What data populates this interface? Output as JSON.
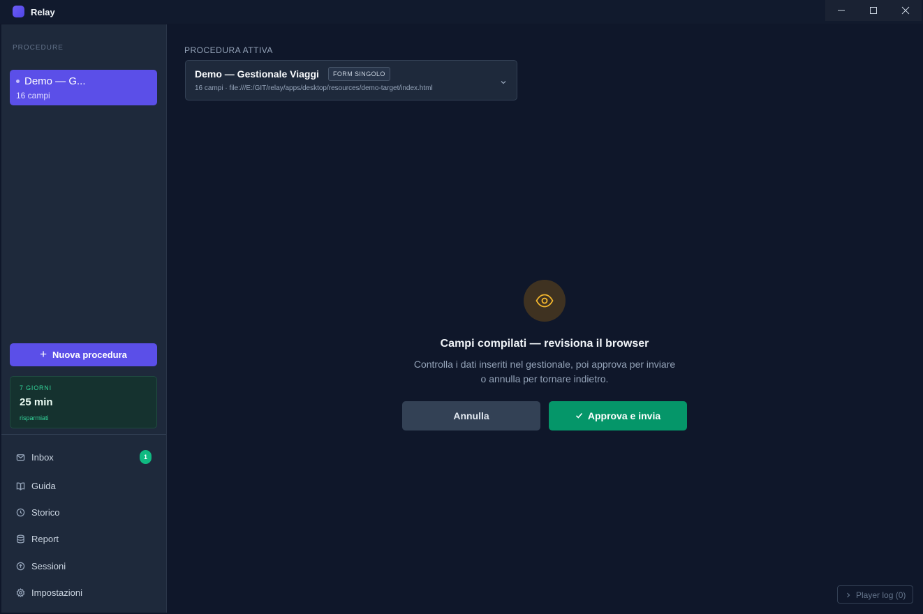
{
  "app": {
    "title": "Relay"
  },
  "sidebar": {
    "section_label": "PROCEDURE",
    "procedures": [
      {
        "title": "Demo — G...",
        "subtitle": "16 campi"
      }
    ],
    "new_button_label": "Nuova procedura",
    "stats": {
      "period": "7 GIORNI",
      "value": "25 min",
      "caption": "risparmiati"
    },
    "nav": [
      {
        "label": "Inbox",
        "icon": "mail-icon",
        "badge": "1"
      },
      {
        "label": "Guida",
        "icon": "book-icon"
      },
      {
        "label": "Storico",
        "icon": "clock-icon"
      },
      {
        "label": "Report",
        "icon": "database-icon"
      },
      {
        "label": "Sessioni",
        "icon": "session-icon"
      },
      {
        "label": "Impostazioni",
        "icon": "gear-icon"
      }
    ]
  },
  "main": {
    "active_label": "PROCEDURA ATTIVA",
    "selector": {
      "title": "Demo — Gestionale Viaggi",
      "tag": "FORM SINGOLO",
      "subtitle": "16 campi · file:///E:/GIT/relay/apps/desktop/resources/demo-target/index.html"
    },
    "review": {
      "icon": "eye-icon",
      "title": "Campi compilati — revisiona il browser",
      "description_line1": "Controlla i dati inseriti nel gestionale, poi approva per inviare",
      "description_line2": "o annulla per tornare indietro.",
      "cancel_label": "Annulla",
      "approve_label": "Approva e invia"
    },
    "player_log_label": "Player log (0)"
  },
  "colors": {
    "accent": "#5b4fe8",
    "success": "#059669",
    "background": "#0f172a",
    "sidebar": "#1e293b",
    "warning_icon": "#f5b82e"
  }
}
